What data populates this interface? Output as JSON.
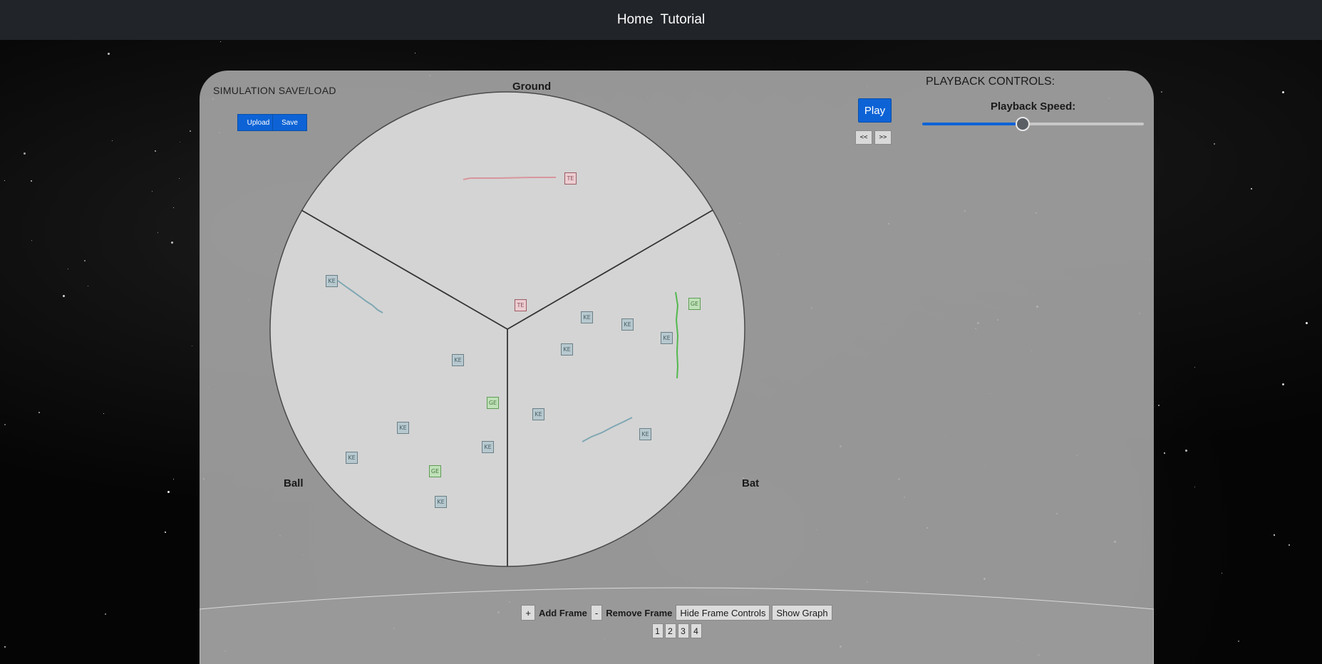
{
  "nav": {
    "home": "Home",
    "tutorial": "Tutorial"
  },
  "save_load": {
    "title": "SIMULATION SAVE/LOAD",
    "upload": "Upload",
    "save": "Save"
  },
  "playback": {
    "title": "PLAYBACK CONTROLS:",
    "play": "Play",
    "prev": "<<",
    "next": ">>",
    "speed_label": "Playback Speed:",
    "speed_fraction": 0.45
  },
  "wheel": {
    "regions": {
      "top": "Ground",
      "left": "Ball",
      "right": "Bat"
    },
    "tags": [
      {
        "type": "TE",
        "label": "TE"
      },
      {
        "type": "KE",
        "label": "KE"
      },
      {
        "type": "TE",
        "label": "TE"
      },
      {
        "type": "KE",
        "label": "KE"
      },
      {
        "type": "KE",
        "label": "KE"
      },
      {
        "type": "KE",
        "label": "KE"
      },
      {
        "type": "KE",
        "label": "KE"
      },
      {
        "type": "GE",
        "label": "GE"
      },
      {
        "type": "KE",
        "label": "KE"
      },
      {
        "type": "GE",
        "label": "GE"
      },
      {
        "type": "KE",
        "label": "KE"
      },
      {
        "type": "KE",
        "label": "KE"
      },
      {
        "type": "KE",
        "label": "KE"
      },
      {
        "type": "KE",
        "label": "KE"
      },
      {
        "type": "GE",
        "label": "GE"
      },
      {
        "type": "KE",
        "label": "KE"
      },
      {
        "type": "KE",
        "label": "KE"
      }
    ],
    "colors": {
      "KE": "#7fa7b3",
      "GE": "#52b84d",
      "TE": "#d8969d"
    }
  },
  "frames": {
    "add_symbol": "+",
    "add_label": "Add Frame",
    "remove_symbol": "-",
    "remove_label": "Remove Frame",
    "hide_controls": "Hide Frame Controls",
    "show_graph": "Show Graph",
    "numbers": [
      "1",
      "2",
      "3",
      "4"
    ]
  }
}
